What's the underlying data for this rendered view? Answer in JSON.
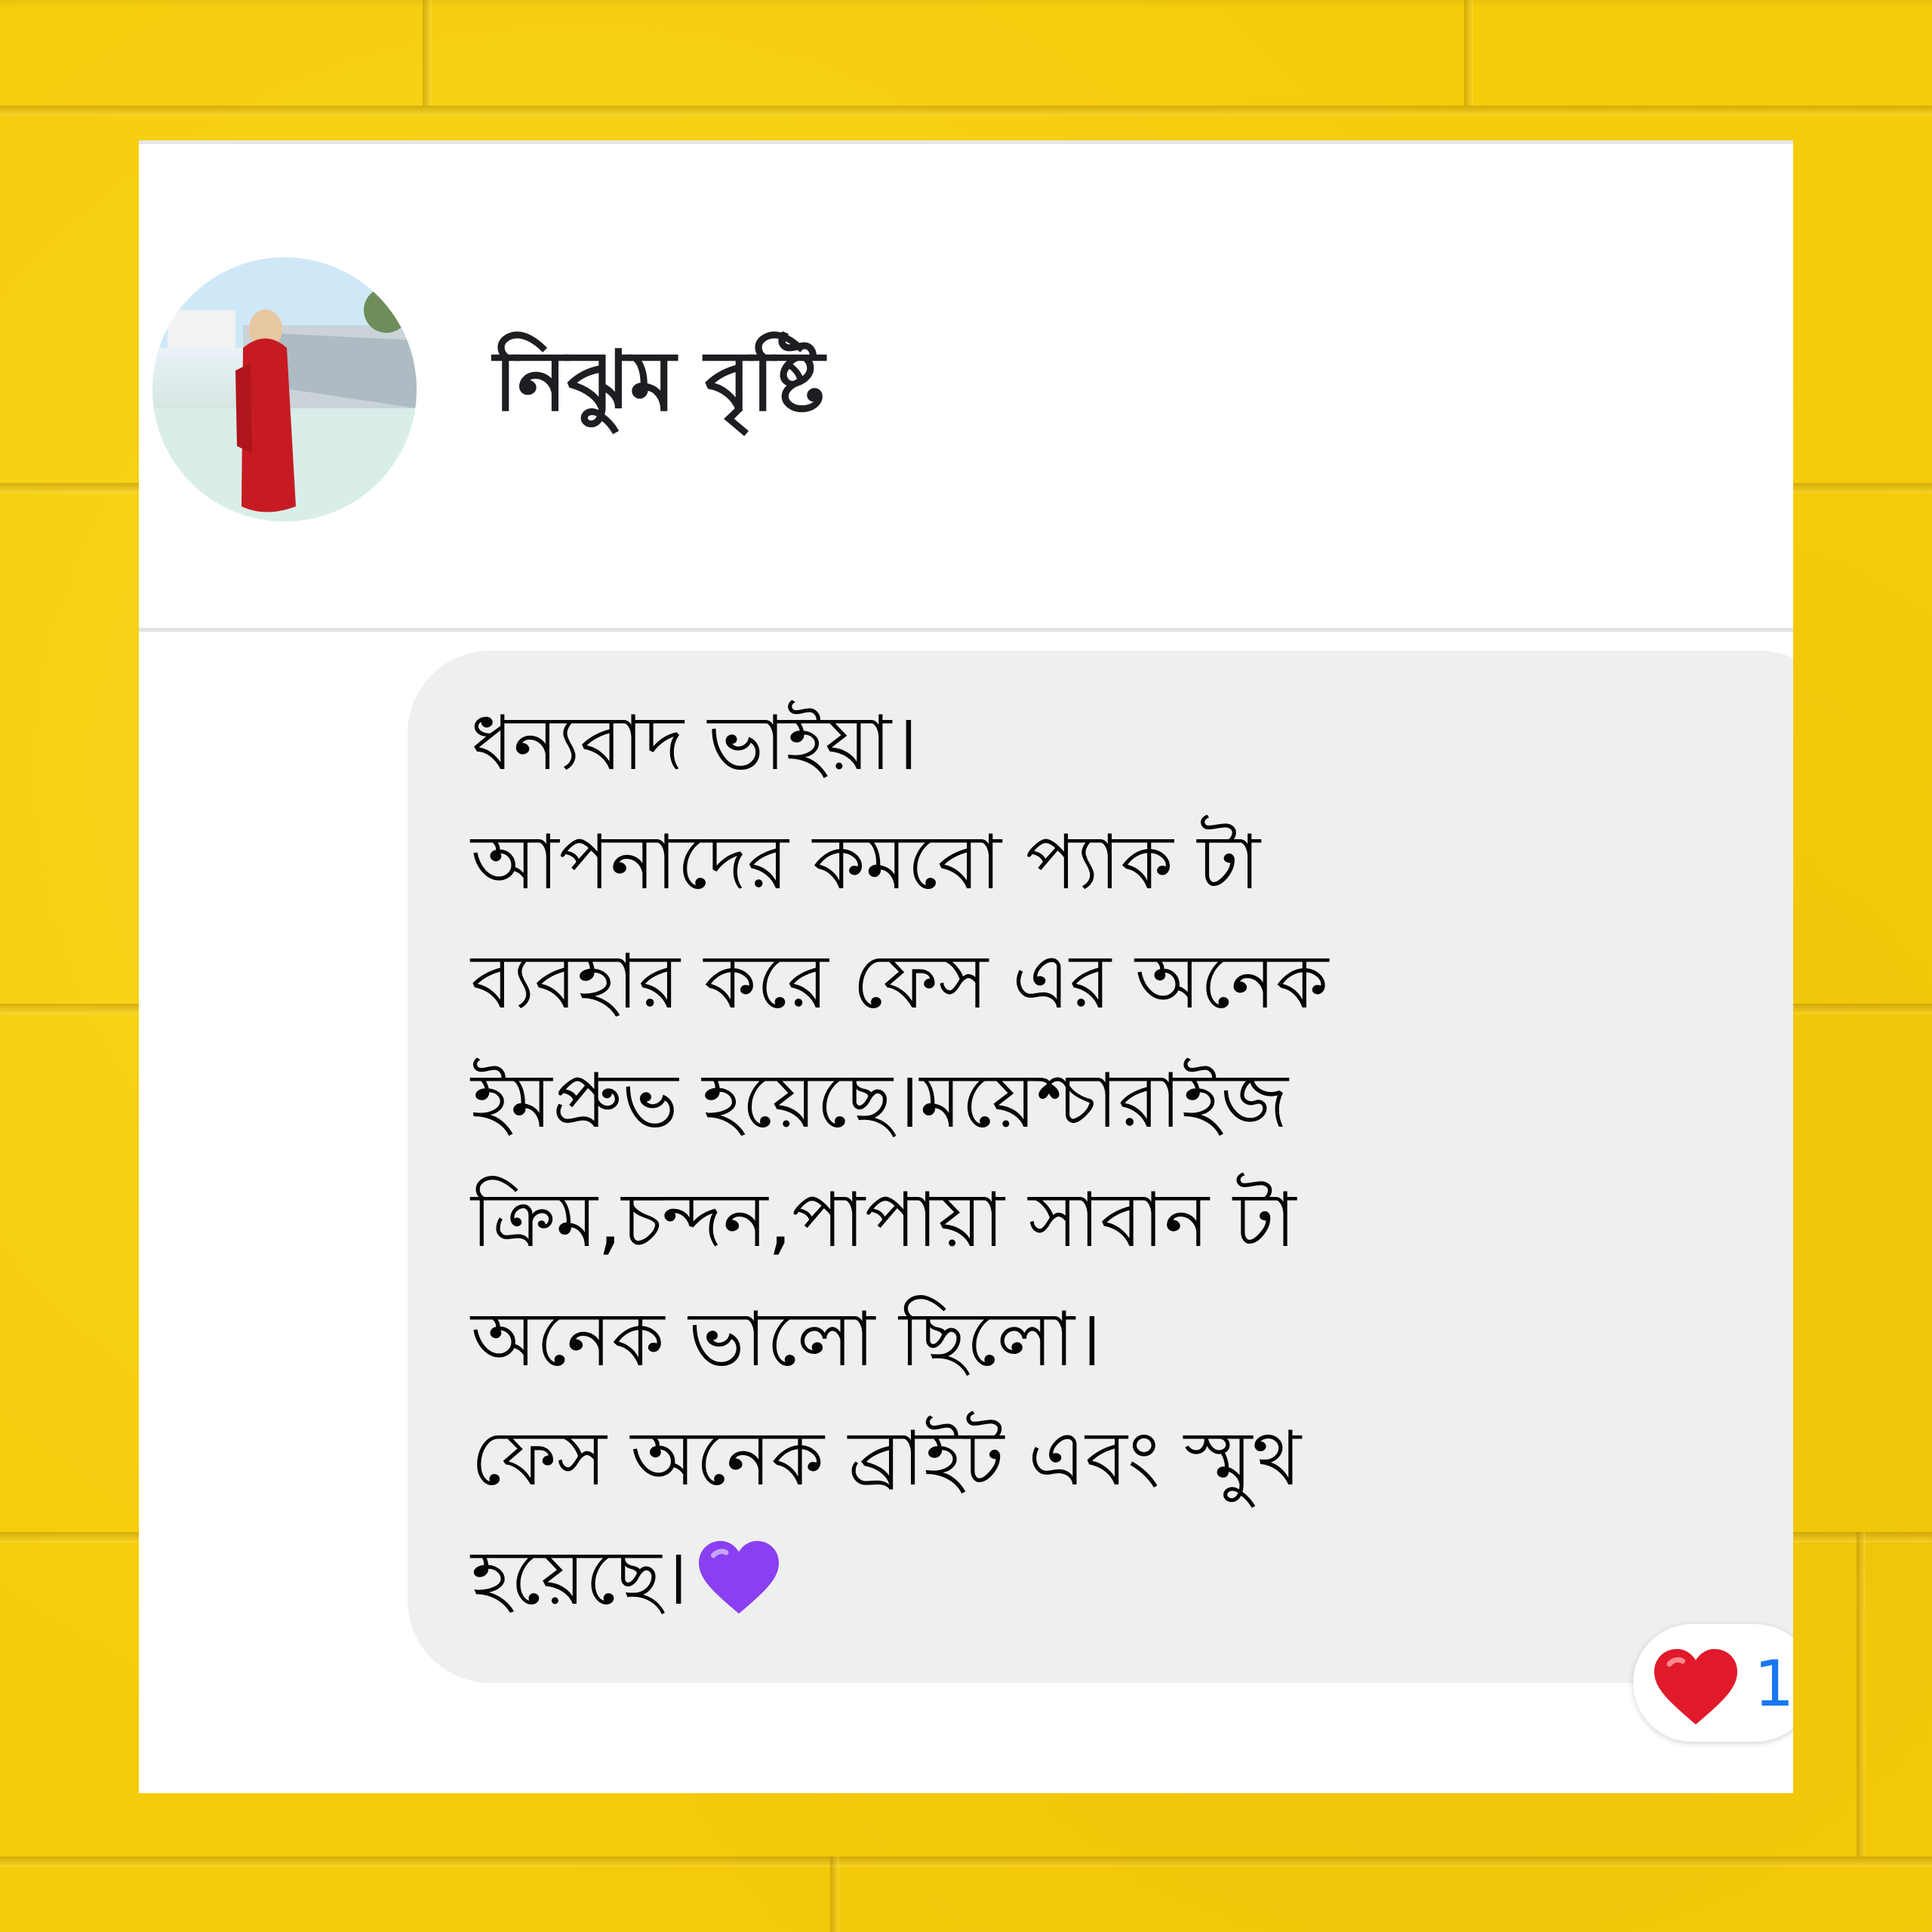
{
  "comment": {
    "author_name": "নিঝুম বৃষ্টি",
    "message_lines": [
      "ধন্যবাদ ভাইয়া।",
      "আপনাদের কমবো প্যাক টা",
      "ব্যবহার করে ফেস এর অনেক",
      "ইমপ্রুভ হয়েছে।ময়েশ্চারাইজ",
      "ক্রিম,চন্দন,পাপায়া সাবান টা",
      "অনেক ভালো ছিলো।",
      "ফেস অনেক ব্রাইট এবং স্মুথ",
      "হয়েছে।"
    ],
    "trailing_emoji": "purple-heart-icon",
    "reaction": {
      "icon": "red-heart-icon",
      "count": "1"
    }
  },
  "colors": {
    "background": "#f5cc0a",
    "card": "#ffffff",
    "bubble": "#efefef",
    "reaction_count": "#1877f2",
    "red_heart": "#e0192b",
    "purple_heart": "#8a3ff0"
  }
}
